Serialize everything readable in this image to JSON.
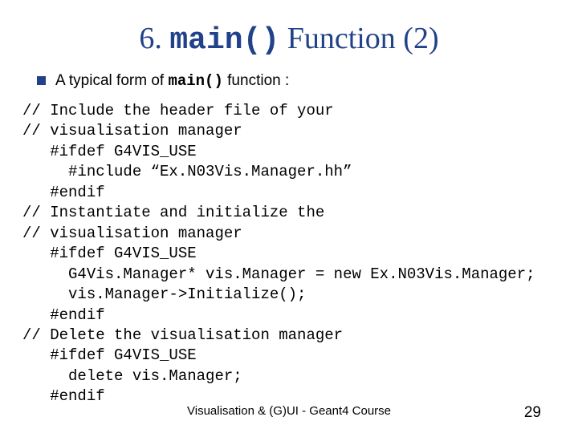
{
  "title_pre": "6. ",
  "title_mono": "main()",
  "title_post": " Function (2)",
  "bullet_pre": "A typical form of ",
  "bullet_mono": "main()",
  "bullet_post": " function :",
  "code": "// Include the header file of your\n// visualisation manager\n   #ifdef G4VIS_USE\n     #include “Ex.N03Vis.Manager.hh”\n   #endif\n// Instantiate and initialize the\n// visualisation manager\n   #ifdef G4VIS_USE\n     G4Vis.Manager* vis.Manager = new Ex.N03Vis.Manager;\n     vis.Manager->Initialize();\n   #endif\n// Delete the visualisation manager\n   #ifdef G4VIS_USE\n     delete vis.Manager;\n   #endif",
  "footer_center": "Visualisation & (G)UI - Geant4 Course",
  "page_number": "29"
}
